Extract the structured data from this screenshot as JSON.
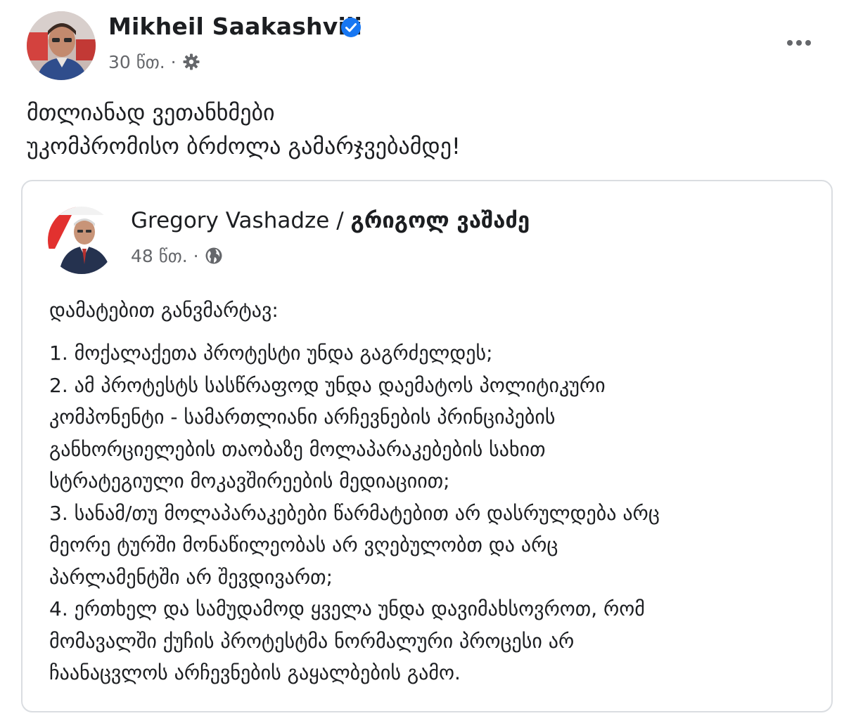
{
  "post": {
    "author": "Mikheil Saakashvili",
    "verified": true,
    "time": "30 წთ.",
    "separator": "·",
    "audience_icon": "gear-icon",
    "more_icon": "more-options-icon",
    "text_lines": [
      "მთლიანად ვეთანხმები",
      "უკომპრომისო ბრძოლა გამარჯვებამდე!"
    ]
  },
  "shared_post": {
    "author_latin": "Gregory Vashadze /",
    "author_georgian": "გრიგოლ ვაშაძე",
    "time": "48 წთ.",
    "separator": "·",
    "audience_icon": "globe-icon",
    "intro": "დამატებით განვმარტავ:",
    "lines": [
      "1. მოქალაქეთა პროტესტი უნდა გაგრძელდეს;",
      "2. ამ  პროტესტს სასწრაფოდ უნდა დაემატოს პოლიტიკური",
      "კომპონენტი - სამართლიანი არჩევნების პრინციპების",
      "განხორციელების თაობაზე მოლაპარაკებების სახით",
      "სტრატეგიული მოკავშირეების მედიაციით;",
      "3. სანამ/თუ მოლაპარაკებები წარმატებით არ დასრულდება არც",
      "მეორე ტურში მონაწილეობას არ ვღებულობთ და არც",
      "პარლამენტში არ შევდივართ;",
      "4. ერთხელ და სამუდამოდ ყველა უნდა დავიმახსოვროთ, რომ",
      "მომავალში ქუჩის პროტესტმა ნორმალური პროცესი არ",
      "ჩაანაცვლოს არჩევნების გაყალბების გამო."
    ]
  },
  "colors": {
    "text": "#1c1e21",
    "secondary": "#65676b",
    "verified_blue": "#1877f2",
    "card_border": "#dadde1"
  }
}
